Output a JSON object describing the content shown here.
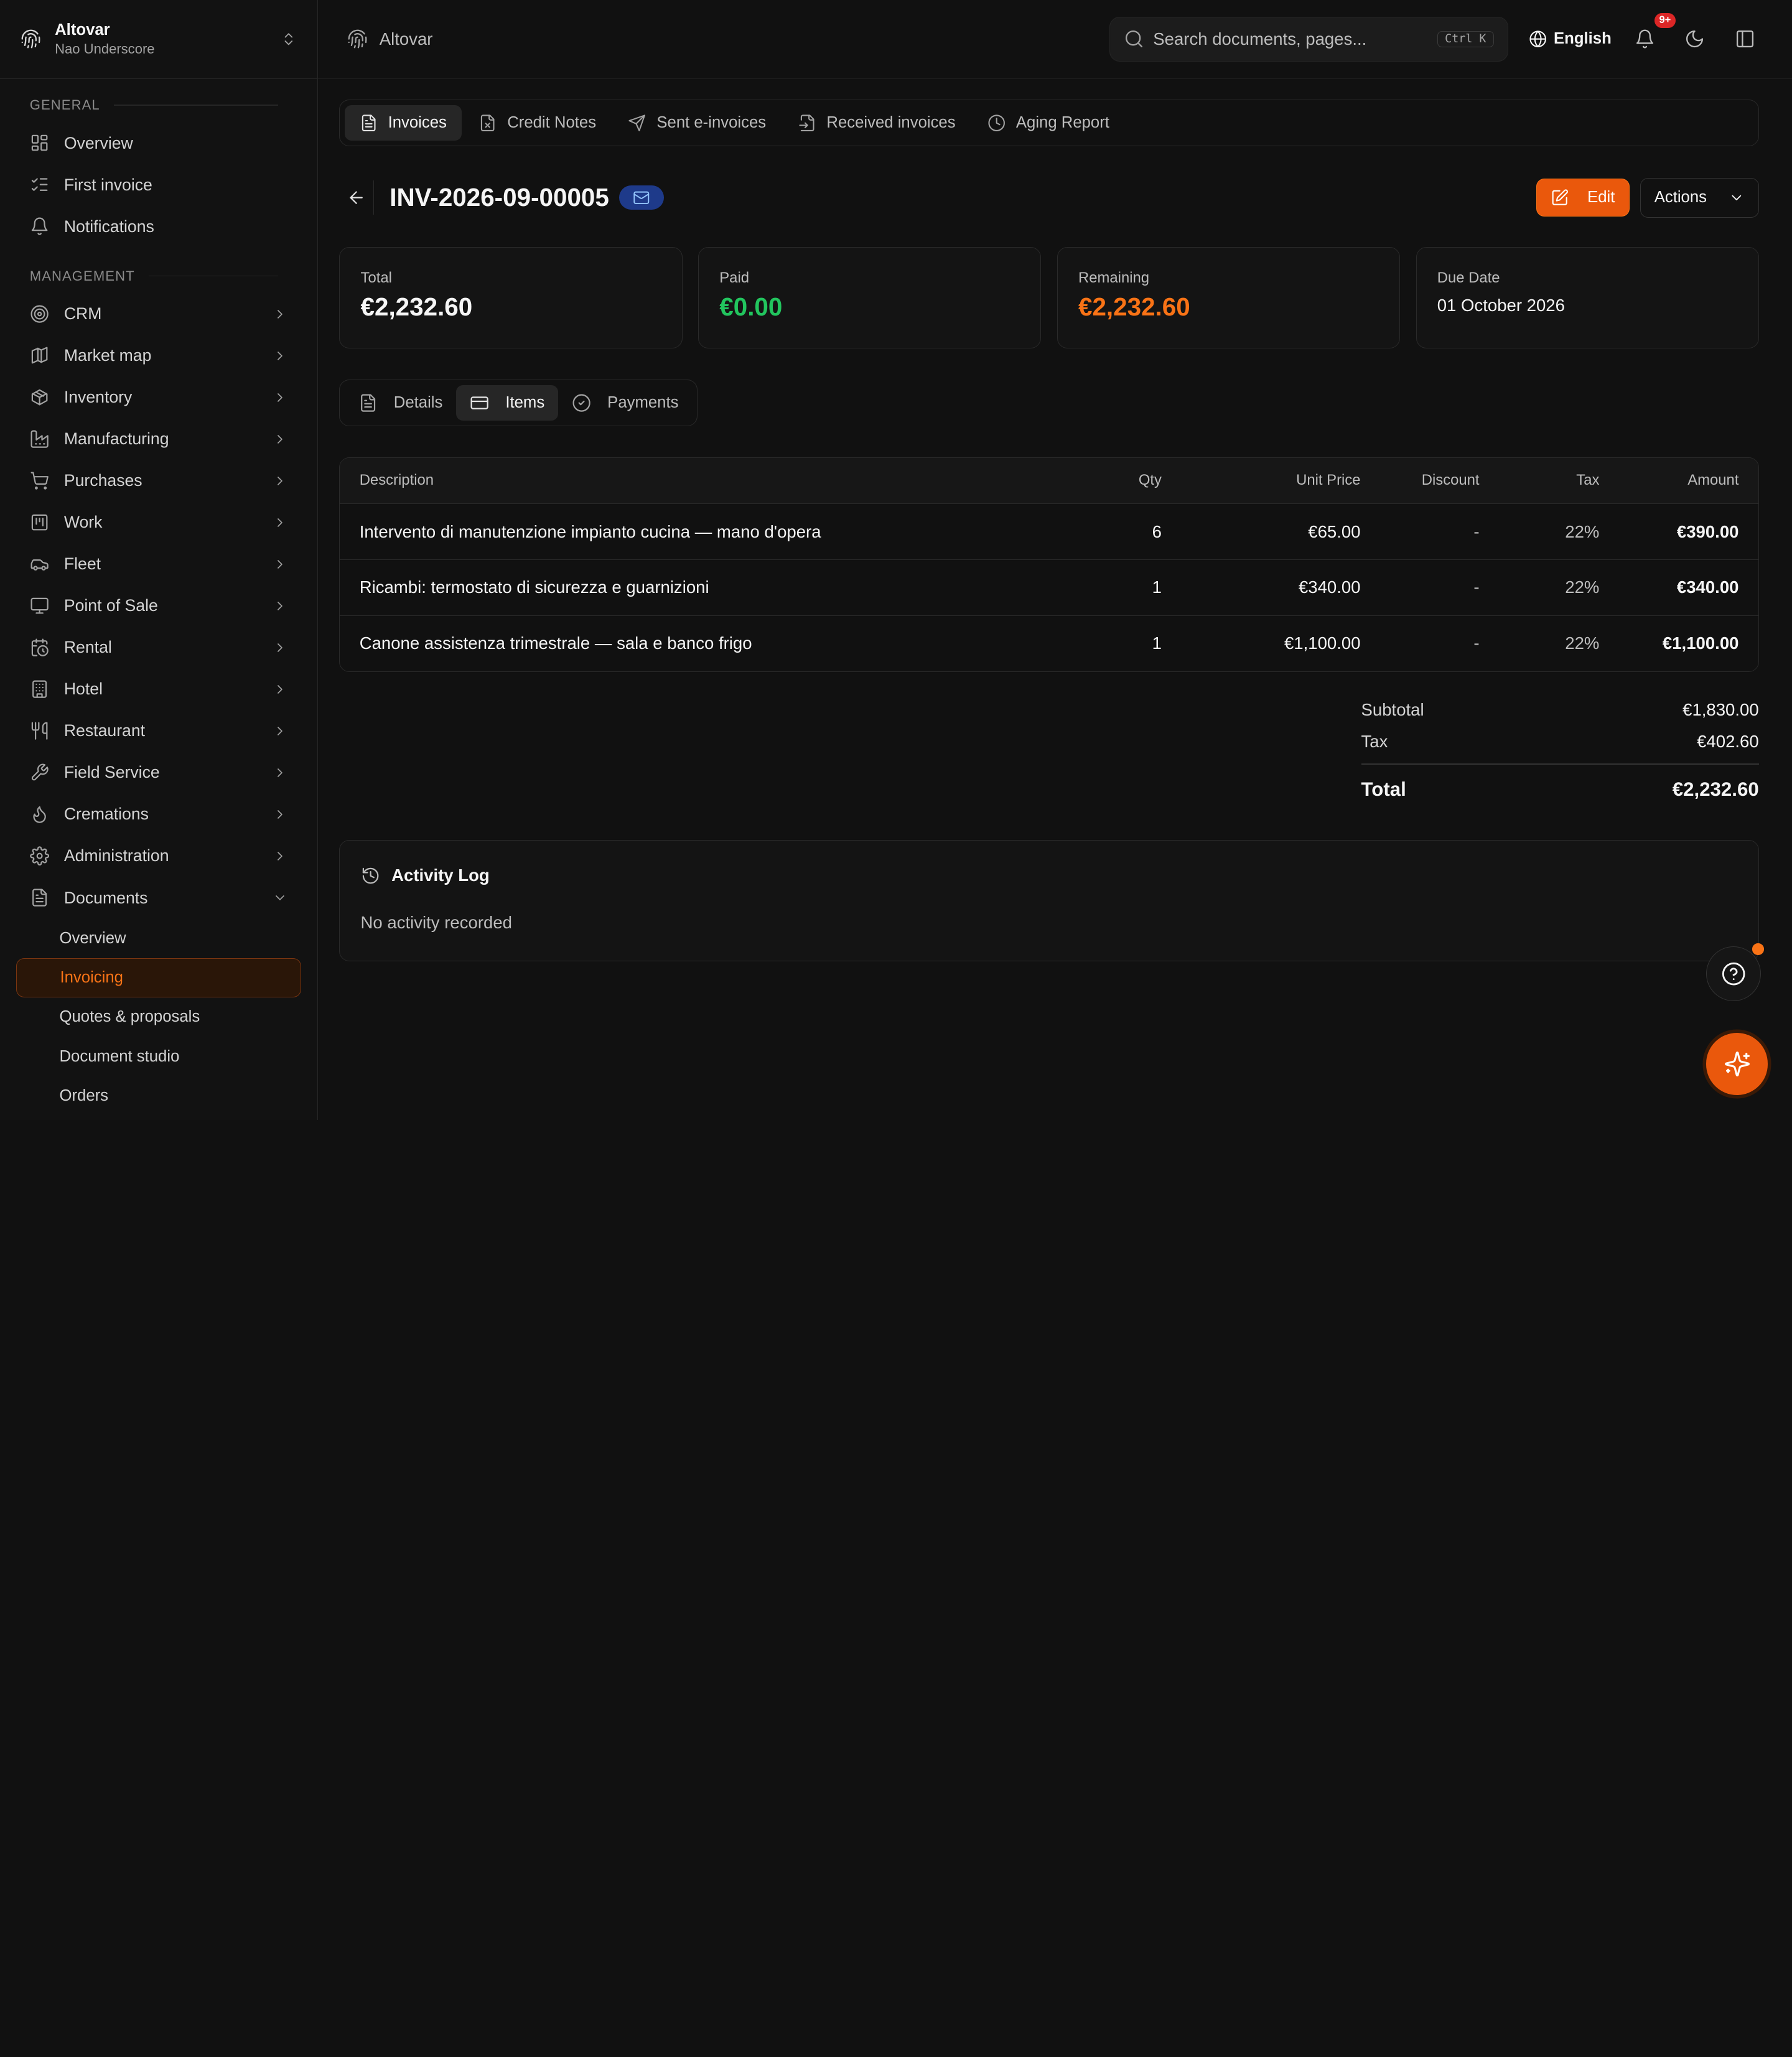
{
  "org": {
    "name": "Altovar",
    "user": "Nao Underscore"
  },
  "sidebar": {
    "general_label": "GENERAL",
    "general": [
      {
        "label": "Overview",
        "icon": "grid-icon"
      },
      {
        "label": "First invoice",
        "icon": "checklist-icon"
      },
      {
        "label": "Notifications",
        "icon": "bell-icon"
      }
    ],
    "management_label": "MANAGEMENT",
    "management": [
      {
        "label": "CRM",
        "icon": "target-icon"
      },
      {
        "label": "Market map",
        "icon": "map-icon"
      },
      {
        "label": "Inventory",
        "icon": "package-icon"
      },
      {
        "label": "Manufacturing",
        "icon": "factory-icon"
      },
      {
        "label": "Purchases",
        "icon": "cart-icon"
      },
      {
        "label": "Work",
        "icon": "kanban-icon"
      },
      {
        "label": "Fleet",
        "icon": "car-icon"
      },
      {
        "label": "Point of Sale",
        "icon": "monitor-icon"
      },
      {
        "label": "Rental",
        "icon": "calendar-clock-icon"
      },
      {
        "label": "Hotel",
        "icon": "building-icon"
      },
      {
        "label": "Restaurant",
        "icon": "utensils-icon"
      },
      {
        "label": "Field Service",
        "icon": "wrench-icon"
      },
      {
        "label": "Cremations",
        "icon": "flame-icon"
      },
      {
        "label": "Administration",
        "icon": "gear-icon"
      },
      {
        "label": "Documents",
        "icon": "file-icon"
      }
    ],
    "documents_sub": [
      "Overview",
      "Invoicing",
      "Quotes & proposals",
      "Document studio",
      "Orders"
    ]
  },
  "topbar": {
    "brand": "Altovar",
    "search_placeholder": "Search documents, pages...",
    "shortcut": "Ctrl K",
    "language": "English",
    "notif_badge": "9+"
  },
  "doc_tabs": [
    "Invoices",
    "Credit Notes",
    "Sent e-invoices",
    "Received invoices",
    "Aging Report"
  ],
  "invoice": {
    "number": "INV-2026-09-00005",
    "edit_label": "Edit",
    "actions_label": "Actions"
  },
  "summary": {
    "total_label": "Total",
    "total": "€2,232.60",
    "paid_label": "Paid",
    "paid": "€0.00",
    "remaining_label": "Remaining",
    "remaining": "€2,232.60",
    "due_label": "Due Date",
    "due": "01 October 2026"
  },
  "detail_tabs": [
    "Details",
    "Items",
    "Payments"
  ],
  "items_table": {
    "headers": [
      "Description",
      "Qty",
      "Unit Price",
      "Discount",
      "Tax",
      "Amount"
    ],
    "rows": [
      [
        "Intervento di manutenzione impianto cucina — mano d'opera",
        "6",
        "€65.00",
        "-",
        "22%",
        "€390.00"
      ],
      [
        "Ricambi: termostato di sicurezza e guarnizioni",
        "1",
        "€340.00",
        "-",
        "22%",
        "€340.00"
      ],
      [
        "Canone assistenza trimestrale — sala e banco frigo",
        "1",
        "€1,100.00",
        "-",
        "22%",
        "€1,100.00"
      ]
    ]
  },
  "totals": {
    "subtotal_label": "Subtotal",
    "subtotal": "€1,830.00",
    "tax_label": "Tax",
    "tax": "€402.60",
    "total_label": "Total",
    "total": "€2,232.60"
  },
  "activity": {
    "title": "Activity Log",
    "empty": "No activity recorded"
  },
  "colors": {
    "accent": "#ea580c",
    "paid": "#22c55e",
    "remaining": "#f97316",
    "badge": "#dc2626"
  }
}
